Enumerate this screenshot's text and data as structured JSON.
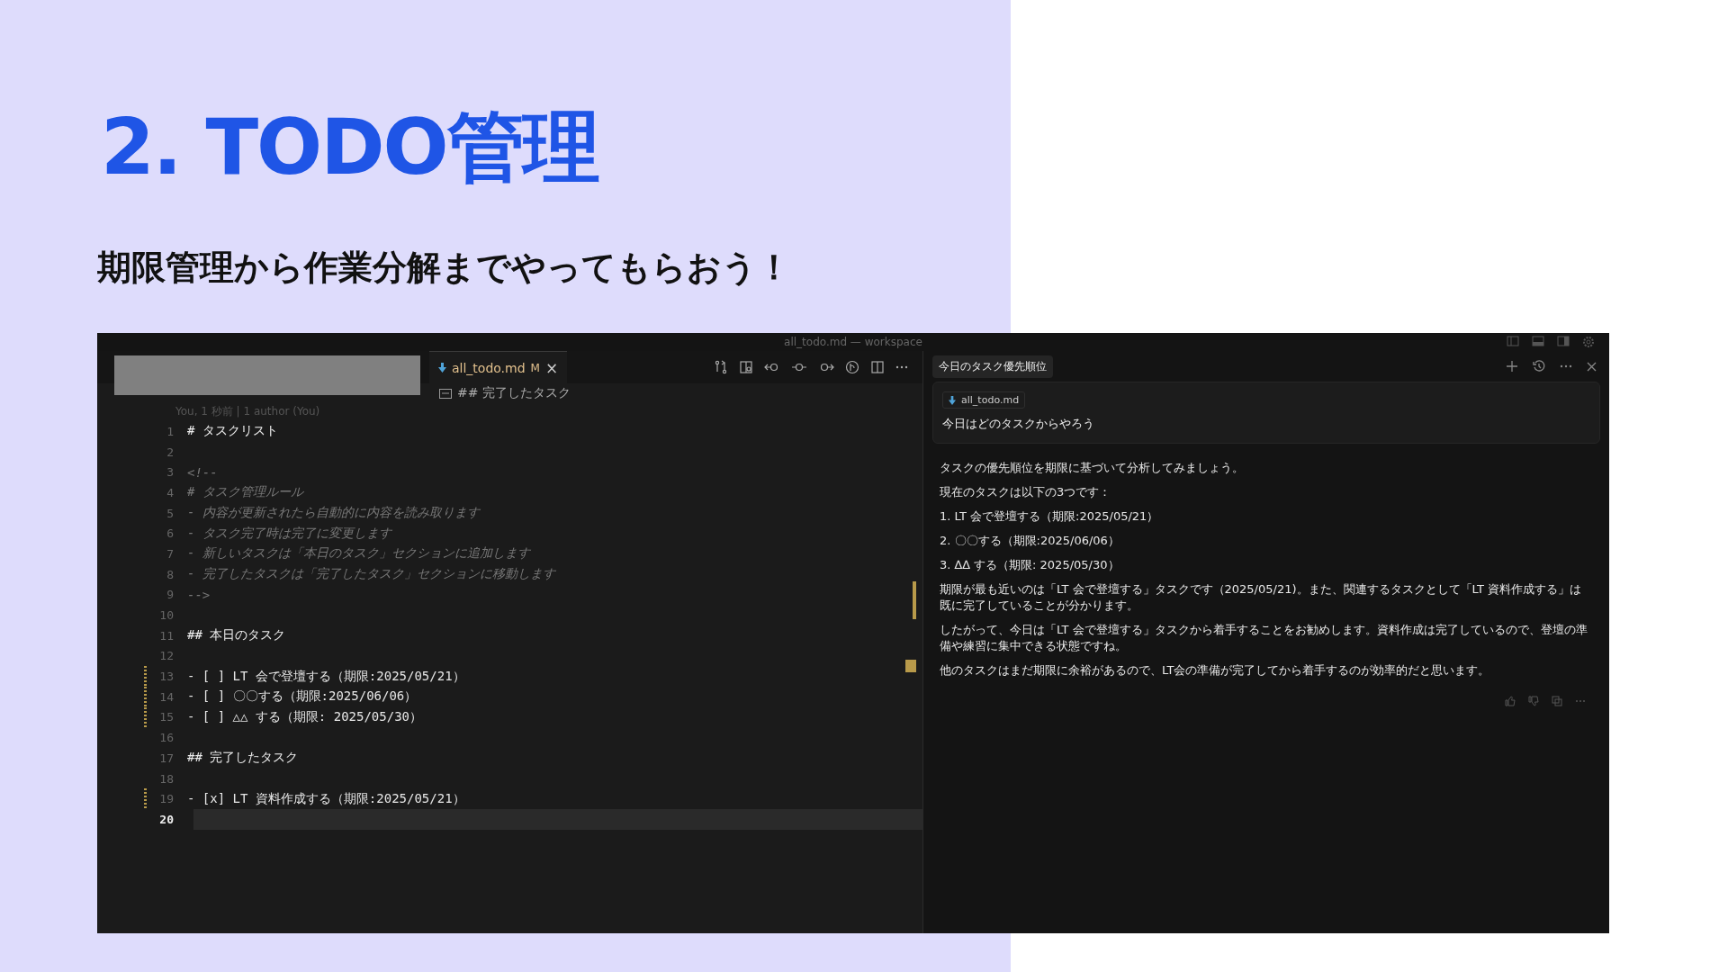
{
  "slide": {
    "title": "2. TODO管理",
    "subtitle": "期限管理から作業分解までやってもらおう！"
  },
  "window": {
    "title": "all_todo.md — workspace"
  },
  "editor": {
    "tab": {
      "label": "all_todo.md",
      "badge": "M",
      "close": "×",
      "selected": true
    },
    "breadcrumb": "## 完了したタスク",
    "blame": "You, 1 秒前 | 1 author (You)",
    "lines": [
      {
        "number": "1",
        "kind": "heading",
        "text": "# タスクリスト"
      },
      {
        "number": "2"
      },
      {
        "number": "3",
        "kind": "comment",
        "text": "<!--"
      },
      {
        "number": "4",
        "kind": "comment",
        "text": "# タスク管理ルール"
      },
      {
        "number": "5",
        "kind": "comment",
        "text": "- 内容が更新されたら自動的に内容を読み取ります"
      },
      {
        "number": "6",
        "kind": "comment",
        "text": "- タスク完了時は完了に変更します"
      },
      {
        "number": "7",
        "kind": "comment",
        "text": "- 新しいタスクは「本日のタスク」セクションに追加します"
      },
      {
        "number": "8",
        "kind": "comment",
        "text": "- 完了したタスクは「完了したタスク」セクションに移動します"
      },
      {
        "number": "9",
        "kind": "comment",
        "text": "-->"
      },
      {
        "number": "10"
      },
      {
        "number": "11",
        "kind": "heading",
        "text": "## 本日のタスク"
      },
      {
        "number": "12"
      },
      {
        "number": "13",
        "kind": "task",
        "text": "- [ ] LT 会で登壇する（期限:2025/05/21）",
        "modified": true
      },
      {
        "number": "14",
        "kind": "task",
        "text": "- [ ] 〇〇する（期限:2025/06/06）",
        "modified": true
      },
      {
        "number": "15",
        "kind": "task",
        "text": "- [ ] △△ する（期限: 2025/05/30）",
        "modified": true
      },
      {
        "number": "16"
      },
      {
        "number": "17",
        "kind": "heading",
        "text": "## 完了したタスク"
      },
      {
        "number": "18"
      },
      {
        "number": "19",
        "kind": "task",
        "text": "- [x] LT 資料作成する（期限:2025/05/21）",
        "modified": true
      },
      {
        "number": "20",
        "current": true
      }
    ]
  },
  "chat": {
    "title": "今日のタスク優先順位",
    "attachment": "all_todo.md",
    "prompt": "今日はどのタスクからやろう",
    "response": [
      "タスクの優先順位を期限に基づいて分析してみましょう。",
      "現在のタスクは以下の3つです：",
      "1. LT 会で登壇する（期限:2025/05/21）",
      "2. 〇〇する（期限:2025/06/06）",
      "3. ∆∆ する（期限: 2025/05/30）",
      "期限が最も近いのは「LT 会で登壇する」タスクです（2025/05/21)。また、関連するタスクとして「LT 資料作成する」は既に完了していることが分かります。",
      "したがって、今日は「LT 会で登壇する」タスクから着手することをお勧めします。資料作成は完了しているので、登壇の準備や練習に集中できる状態ですね。",
      "他のタスクはまだ期限に余裕があるので、LT会の準備が完了してから着手するのが効率的だと思います。"
    ]
  }
}
